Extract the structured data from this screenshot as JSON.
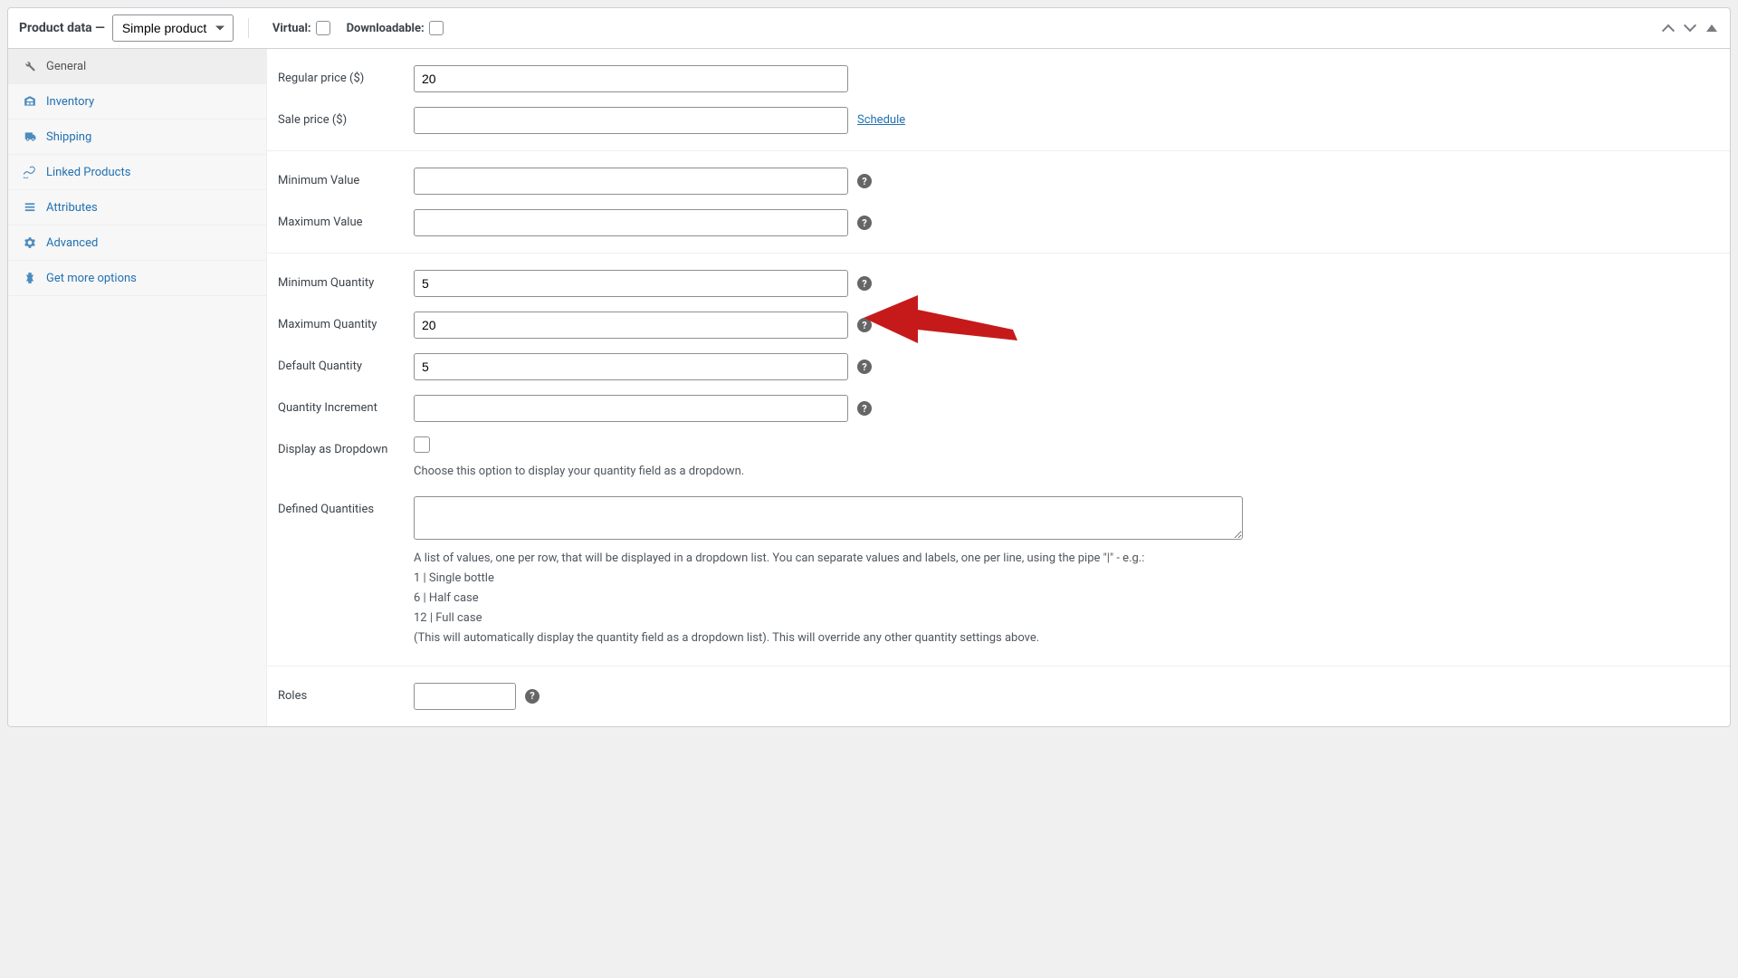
{
  "header": {
    "title": "Product data —",
    "product_type": "Simple product",
    "virtual_label": "Virtual:",
    "downloadable_label": "Downloadable:"
  },
  "sidebar": {
    "items": [
      {
        "label": "General",
        "icon": "wrench-icon"
      },
      {
        "label": "Inventory",
        "icon": "inventory-icon"
      },
      {
        "label": "Shipping",
        "icon": "truck-icon"
      },
      {
        "label": "Linked Products",
        "icon": "link-icon"
      },
      {
        "label": "Attributes",
        "icon": "list-icon"
      },
      {
        "label": "Advanced",
        "icon": "gear-icon"
      },
      {
        "label": "Get more options",
        "icon": "plugin-icon"
      }
    ]
  },
  "fields": {
    "regular_price": {
      "label": "Regular price ($)",
      "value": "20"
    },
    "sale_price": {
      "label": "Sale price ($)",
      "value": "",
      "schedule_link": "Schedule"
    },
    "min_value": {
      "label": "Minimum Value",
      "value": ""
    },
    "max_value": {
      "label": "Maximum Value",
      "value": ""
    },
    "min_qty": {
      "label": "Minimum Quantity",
      "value": "5"
    },
    "max_qty": {
      "label": "Maximum Quantity",
      "value": "20"
    },
    "default_qty": {
      "label": "Default Quantity",
      "value": "5"
    },
    "qty_increment": {
      "label": "Quantity Increment",
      "value": ""
    },
    "display_dropdown": {
      "label": "Display as Dropdown",
      "desc": "Choose this option to display your quantity field as a dropdown."
    },
    "defined_qty": {
      "label": "Defined Quantities",
      "value": "",
      "desc_line1": "A list of values, one per row, that will be displayed in a dropdown list. You can separate values and labels, one per line, using the pipe \"|\" - e.g.:",
      "desc_line2": "1 | Single bottle",
      "desc_line3": "6 | Half case",
      "desc_line4": "12 | Full case",
      "desc_line5": "(This will automatically display the quantity field as a dropdown list). This will override any other quantity settings above."
    },
    "roles": {
      "label": "Roles",
      "value": ""
    }
  }
}
